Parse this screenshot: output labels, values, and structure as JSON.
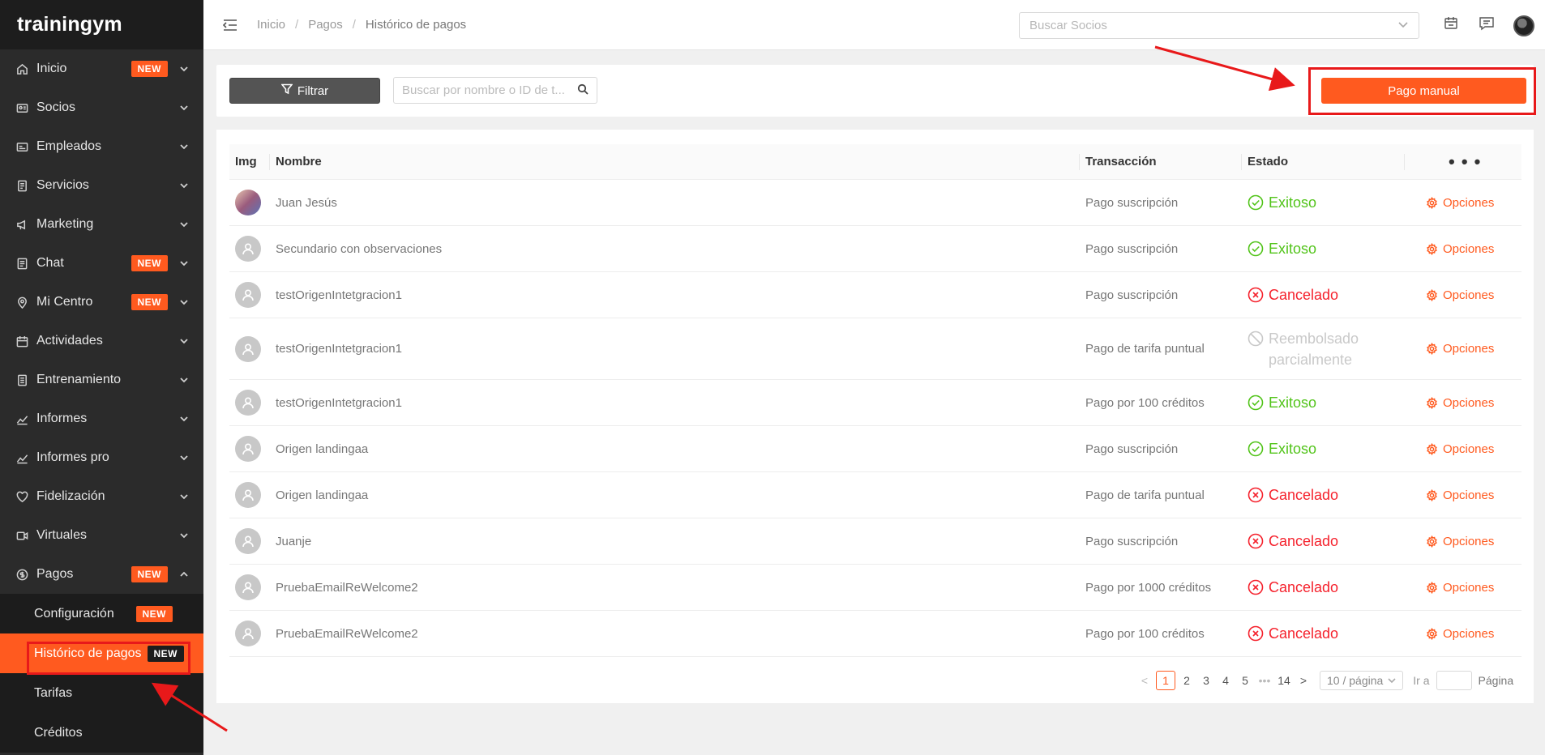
{
  "app": {
    "logo": "trainingym"
  },
  "sidebar": {
    "items": [
      {
        "label": "Inicio",
        "icon": "home-icon",
        "badge": "NEW"
      },
      {
        "label": "Socios",
        "icon": "id-card-icon",
        "badge": ""
      },
      {
        "label": "Empleados",
        "icon": "badge-icon",
        "badge": ""
      },
      {
        "label": "Servicios",
        "icon": "document-icon",
        "badge": ""
      },
      {
        "label": "Marketing",
        "icon": "megaphone-icon",
        "badge": ""
      },
      {
        "label": "Chat",
        "icon": "chat-icon",
        "badge": "NEW"
      },
      {
        "label": "Mi Centro",
        "icon": "location-icon",
        "badge": "NEW"
      },
      {
        "label": "Actividades",
        "icon": "calendar-icon",
        "badge": ""
      },
      {
        "label": "Entrenamiento",
        "icon": "dumbbell-icon",
        "badge": ""
      },
      {
        "label": "Informes",
        "icon": "chart-icon",
        "badge": ""
      },
      {
        "label": "Informes pro",
        "icon": "chart-pro-icon",
        "badge": ""
      },
      {
        "label": "Fidelización",
        "icon": "heart-icon",
        "badge": ""
      },
      {
        "label": "Virtuales",
        "icon": "video-icon",
        "badge": ""
      },
      {
        "label": "Pagos",
        "icon": "dollar-icon",
        "badge": "NEW"
      }
    ],
    "pagos_sub": [
      {
        "label": "Configuración",
        "badge": "NEW"
      },
      {
        "label": "Histórico de pagos",
        "badge": "NEW"
      },
      {
        "label": "Tarifas",
        "badge": ""
      },
      {
        "label": "Créditos",
        "badge": ""
      }
    ]
  },
  "header": {
    "breadcrumb": [
      "Inicio",
      "Pagos",
      "Histórico de pagos"
    ],
    "search_socios_placeholder": "Buscar Socios"
  },
  "toolbar": {
    "filter_label": "Filtrar",
    "search_placeholder": "Buscar por nombre o ID de t...",
    "manual_label": "Pago manual"
  },
  "table": {
    "headers": {
      "img": "Img",
      "name": "Nombre",
      "trx": "Transacción",
      "estado": "Estado",
      "more": "• • •"
    },
    "rows": [
      {
        "name": "Juan Jesús",
        "trx": "Pago suscripción",
        "estado": "Exitoso",
        "status": "ok",
        "photo": true
      },
      {
        "name": "Secundario con observaciones",
        "trx": "Pago suscripción",
        "estado": "Exitoso",
        "status": "ok",
        "photo": false
      },
      {
        "name": "testOrigenIntetgracion1",
        "trx": "Pago suscripción",
        "estado": "Cancelado",
        "status": "cancel",
        "photo": false
      },
      {
        "name": "testOrigenIntetgracion1",
        "trx": "Pago de tarifa puntual",
        "estado": "Reembolsado parcialmente",
        "status": "partial",
        "photo": false
      },
      {
        "name": "testOrigenIntetgracion1",
        "trx": "Pago por 100 créditos",
        "estado": "Exitoso",
        "status": "ok",
        "photo": false
      },
      {
        "name": "Origen landingaa",
        "trx": "Pago suscripción",
        "estado": "Exitoso",
        "status": "ok",
        "photo": false
      },
      {
        "name": "Origen landingaa",
        "trx": "Pago de tarifa puntual",
        "estado": "Cancelado",
        "status": "cancel",
        "photo": false
      },
      {
        "name": "Juanje",
        "trx": "Pago suscripción",
        "estado": "Cancelado",
        "status": "cancel",
        "photo": false
      },
      {
        "name": "PruebaEmailReWelcome2",
        "trx": "Pago por 1000 créditos",
        "estado": "Cancelado",
        "status": "cancel",
        "photo": false
      },
      {
        "name": "PruebaEmailReWelcome2",
        "trx": "Pago por 100 créditos",
        "estado": "Cancelado",
        "status": "cancel",
        "photo": false
      }
    ],
    "options_label": "Opciones"
  },
  "pagination": {
    "prev": "<",
    "pages": [
      "1",
      "2",
      "3",
      "4",
      "5",
      "•••",
      "14"
    ],
    "current": "1",
    "next": ">",
    "page_size": "10 / página",
    "goto_label": "Ir a",
    "page_word": "Página"
  },
  "colors": {
    "accent": "#ff5a1f",
    "sidebar": "#2b2b2b",
    "success": "#52c41a",
    "danger": "#f5222d",
    "annotation": "#e8191a"
  }
}
